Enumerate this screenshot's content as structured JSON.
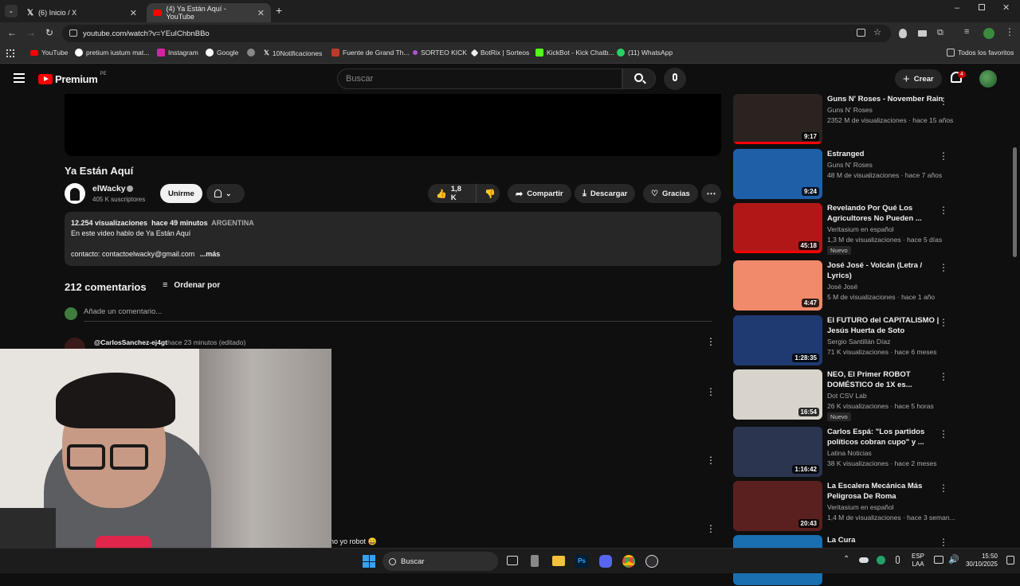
{
  "browser": {
    "tabs": [
      {
        "title": "(6) Inicio / X"
      },
      {
        "title": "(4) Ya Están Aquí - YouTube"
      }
    ],
    "url": "youtube.com/watch?v=YEuIChbnBBo",
    "bookmarks": [
      "YouTube",
      "pretium iustum mat...",
      "Instagram",
      "Google",
      "10Notificaciones",
      "Fuente de Grand Th...",
      "SORTEO KICK",
      "BotRix | Sorteos",
      "KickBot - Kick Chatb...",
      "(11) WhatsApp"
    ],
    "all_bookmarks": "Todos los favoritos"
  },
  "youtube": {
    "logo": "Premium",
    "logo_region": "PE",
    "search_placeholder": "Buscar",
    "create_label": "Crear",
    "notifications_count": "4"
  },
  "video": {
    "title": "Ya Están Aquí",
    "channel": "elWacky",
    "subscribers": "405 K suscriptores",
    "join_label": "Unirme",
    "likes": "1,8 K",
    "share_label": "Compartir",
    "download_label": "Descargar",
    "thanks_label": "Gracias",
    "views": "12.254 visualizaciones",
    "posted": "hace 49 minutos",
    "tag": "ARGENTINA",
    "description_line1": "En este video hablo de Ya Están Aquí",
    "description_line2": "contacto: contactoelwacky@gmail.com",
    "more_label": "...más"
  },
  "comments": {
    "count_label": "212 comentarios",
    "sort_label": "Ordenar por",
    "add_placeholder": "Añade un comentario...",
    "first_author": "@CarlosSanchez-ej4gt",
    "first_time": "hace 23 minutos (editado)",
    "partial_text": "no yo robot 😄"
  },
  "recommendations": [
    {
      "title": "Guns N' Roses - November Rain",
      "channel": "Guns N' Roses",
      "meta": "2352 M de visualizaciones · hace 15 años",
      "duration": "9:17",
      "badge": "",
      "thumb_color": "#2a2320"
    },
    {
      "title": "Estranged",
      "channel": "Guns N' Roses",
      "meta": "48 M de visualizaciones · hace 7 años",
      "duration": "9:24",
      "badge": "",
      "thumb_color": "#1f5fa8"
    },
    {
      "title": "Revelando Por Qué Los Agricultores No Pueden ...",
      "channel": "Veritasium en español",
      "meta": "1,3 M de visualizaciones · hace 5 días",
      "duration": "45:18",
      "badge": "Nuevo",
      "thumb_color": "#b01818"
    },
    {
      "title": "José José - Volcán (Letra / Lyrics)",
      "channel": "José José",
      "meta": "5 M de visualizaciones · hace 1 año",
      "duration": "4:47",
      "badge": "",
      "thumb_color": "#f08a6a"
    },
    {
      "title": "El FUTURO del CAPITALISMO | Jesús Huerta de Soto",
      "channel": "Sergio Santillán Díaz",
      "meta": "71 K visualizaciones · hace 6 meses",
      "duration": "1:28:35",
      "badge": "",
      "thumb_color": "#1e3a70"
    },
    {
      "title": "NEO, El Primer ROBOT DOMÉSTICO de 1X es...",
      "channel": "Dot CSV Lab",
      "meta": "26 K visualizaciones · hace 5 horas",
      "duration": "16:54",
      "badge": "Nuevo",
      "thumb_color": "#d8d4cc"
    },
    {
      "title": "Carlos Espá: \"Los partidos políticos cobran cupo\" y ...",
      "channel": "Latina Noticias",
      "meta": "38 K visualizaciones · hace 2 meses",
      "duration": "1:16:42",
      "badge": "",
      "thumb_color": "#2b3550"
    },
    {
      "title": "La Escalera Mecánica Más Peligrosa De Roma",
      "channel": "Veritasium en español",
      "meta": "1,4 M de visualizaciones · hace 3 seman...",
      "duration": "20:43",
      "badge": "",
      "thumb_color": "#5a2020"
    },
    {
      "title": "La Cura",
      "channel": "",
      "meta": "",
      "duration": "",
      "badge": "",
      "thumb_color": "#1a6fb0"
    }
  ],
  "taskbar": {
    "search_label": "Buscar",
    "lang": "ESP",
    "lang2": "LAA",
    "time": "15:50",
    "date": "30/10/2025"
  }
}
